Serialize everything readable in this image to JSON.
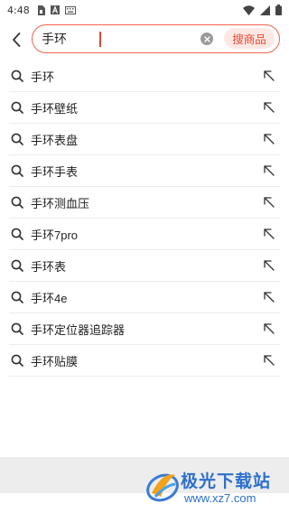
{
  "status_bar": {
    "time": "4:48",
    "left_icons": [
      "sim-card-icon",
      "text-a-icon",
      "keyboard-icon"
    ],
    "right_icons": [
      "wifi-icon",
      "signal-icon",
      "battery-icon"
    ]
  },
  "search": {
    "query": "手环",
    "action_label": "搜商品"
  },
  "suggestions": [
    {
      "text": "手环"
    },
    {
      "text": "手环壁纸"
    },
    {
      "text": "手环表盘"
    },
    {
      "text": "手环手表"
    },
    {
      "text": "手环测血压"
    },
    {
      "text": "手环7pro"
    },
    {
      "text": "手环表"
    },
    {
      "text": "手环4e"
    },
    {
      "text": "手环定位器追踪器"
    },
    {
      "text": "手环贴膜"
    }
  ],
  "watermark": {
    "title": "极光下载站",
    "url": "www.xz7.com"
  },
  "colors": {
    "accent": "#f0634a",
    "accent_text": "#e8452f",
    "accent_bg": "#fde8e4",
    "watermark": "#2d6fcc",
    "bottom_bar": "#ededed"
  }
}
